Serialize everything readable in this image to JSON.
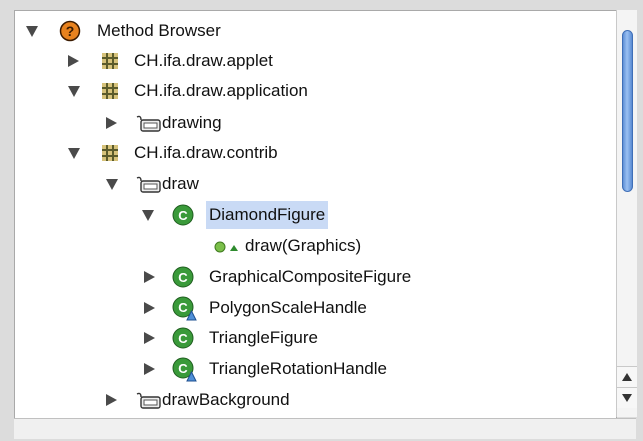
{
  "tree": {
    "nodes": [
      {
        "label": "Method Browser",
        "icon": "help-icon",
        "expander": "expanded",
        "depth": 0
      },
      {
        "label": "CH.ifa.draw.applet",
        "icon": "package-icon",
        "expander": "collapsed",
        "depth": 1
      },
      {
        "label": "CH.ifa.draw.application",
        "icon": "package-icon",
        "expander": "expanded",
        "depth": 1
      },
      {
        "label": "drawing",
        "icon": "folder-icon",
        "expander": "collapsed",
        "depth": 2
      },
      {
        "label": "CH.ifa.draw.contrib",
        "icon": "package-icon",
        "expander": "expanded",
        "depth": 1
      },
      {
        "label": "draw",
        "icon": "folder-icon",
        "expander": "expanded",
        "depth": 2
      },
      {
        "label": "DiamondFigure",
        "icon": "class-icon",
        "expander": "expanded",
        "depth": 3,
        "selected": true
      },
      {
        "label": "draw(Graphics)",
        "icon": "method-icon",
        "expander": "none",
        "depth": 4
      },
      {
        "label": "GraphicalCompositeFigure",
        "icon": "class-icon",
        "expander": "collapsed",
        "depth": 3
      },
      {
        "label": "PolygonScaleHandle",
        "icon": "class-abstract-icon",
        "expander": "collapsed",
        "depth": 3
      },
      {
        "label": "TriangleFigure",
        "icon": "class-icon",
        "expander": "collapsed",
        "depth": 3
      },
      {
        "label": "TriangleRotationHandle",
        "icon": "class-abstract-icon",
        "expander": "collapsed",
        "depth": 3
      },
      {
        "label": "drawBackground",
        "icon": "folder-icon",
        "expander": "collapsed",
        "depth": 2
      }
    ]
  },
  "colors": {
    "selection": "#c9daf5",
    "class_green": "#3a9a3a",
    "help_orange": "#e8821e",
    "scroll_thumb": "#6d9ee3"
  }
}
